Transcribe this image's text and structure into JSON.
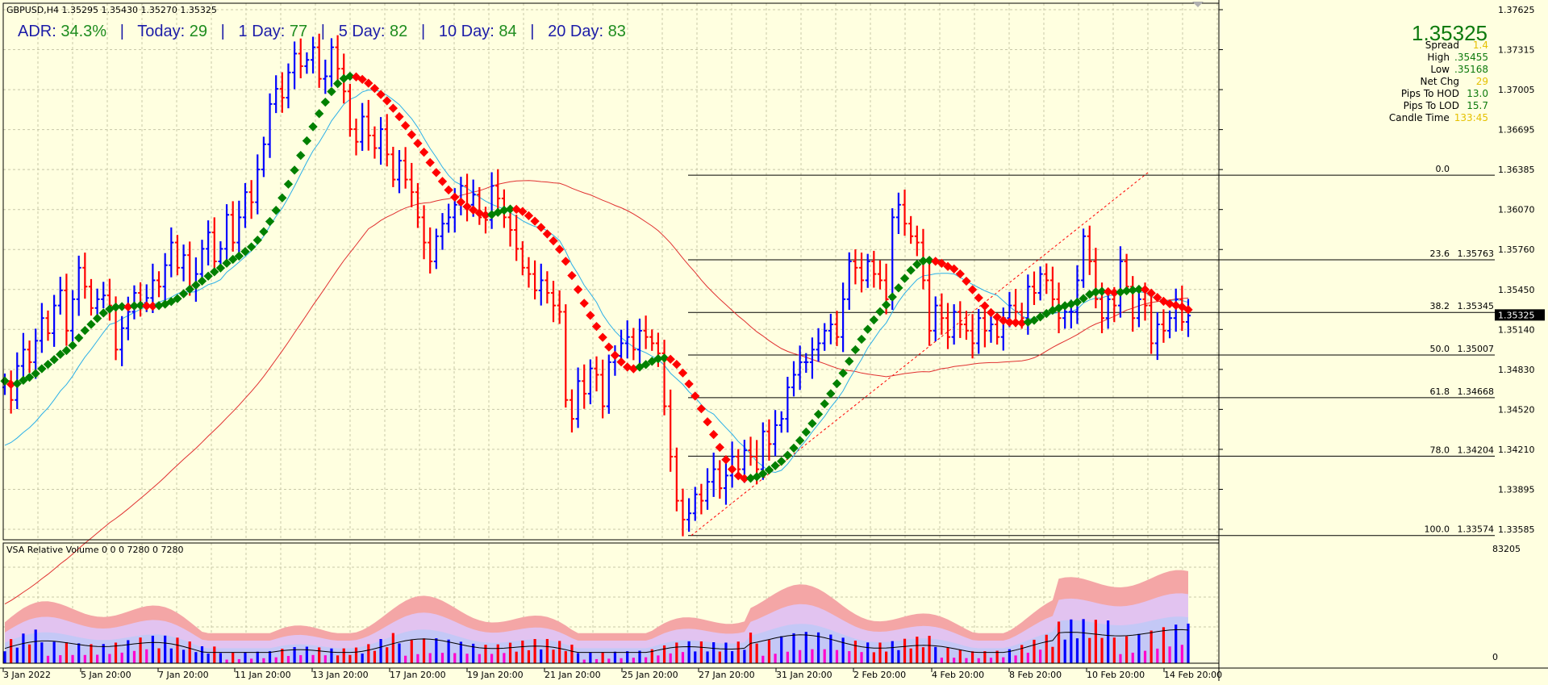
{
  "symbol_header": "GBPUSD,H4  1.35295 1.35430 1.35270 1.35325",
  "adr": {
    "parts": [
      {
        "label": "ADR:",
        "value": "34.3%",
        "sep": "|"
      },
      {
        "label": "Today:",
        "value": "29",
        "sep": "|"
      },
      {
        "label": "1 Day:",
        "value": "77",
        "sep": "|"
      },
      {
        "label": "5 Day:",
        "value": "82",
        "sep": "|"
      },
      {
        "label": "10 Day:",
        "value": "84",
        "sep": "|"
      },
      {
        "label": "20 Day:",
        "value": "83",
        "sep": ""
      }
    ]
  },
  "info_panel": {
    "price": "1.35325",
    "rows": [
      {
        "label": "Spread",
        "value": "1.4",
        "color": "yellow"
      },
      {
        "label": "High",
        "value": ".35455",
        "color": "green"
      },
      {
        "label": "Low",
        "value": ".35168",
        "color": "green"
      },
      {
        "label": "Net Chg",
        "value": "29",
        "color": "yellow"
      },
      {
        "label": "Pips To HOD",
        "value": "13.0",
        "color": "green"
      },
      {
        "label": "Pips To LOD",
        "value": "15.7",
        "color": "green"
      },
      {
        "label": "Candle Time",
        "value": "133:45",
        "color": "yellow"
      }
    ]
  },
  "indicator_header": "VSA Relative Volume 0 0 0 7280 0 7280",
  "colors": {
    "background": "#FFFFE0",
    "up_bar": "#0000FF",
    "down_bar": "#FF0000",
    "ma_fast": "#2CB0E8",
    "ma_slow": "#E03030",
    "trail_up": "#008000",
    "trail_down": "#FF0000",
    "grid": "#C8C8A8"
  },
  "chart_data": {
    "type": "ohlc",
    "title": "GBPUSD,H4",
    "ylim": [
      1.3354,
      1.378
    ],
    "y_ticks": [
      "1.37625",
      "1.37315",
      "1.37005",
      "1.36695",
      "1.36385",
      "1.36070",
      "1.35760",
      "1.35450",
      "1.35140",
      "1.34830",
      "1.34520",
      "1.34210",
      "1.33895",
      "1.33585"
    ],
    "current_price_label": "1.35325",
    "current_price": 1.35325,
    "x_ticks": [
      "3 Jan 2022",
      "5 Jan 20:00",
      "7 Jan 20:00",
      "11 Jan 20:00",
      "13 Jan 20:00",
      "17 Jan 20:00",
      "19 Jan 20:00",
      "21 Jan 20:00",
      "25 Jan 20:00",
      "27 Jan 20:00",
      "31 Jan 20:00",
      "2 Feb 20:00",
      "4 Feb 20:00",
      "8 Feb 20:00",
      "10 Feb 20:00",
      "14 Feb 20:00"
    ],
    "closes": [
      1.348,
      1.3465,
      1.3492,
      1.3505,
      1.3495,
      1.3512,
      1.353,
      1.3518,
      1.354,
      1.3552,
      1.352,
      1.3545,
      1.357,
      1.3555,
      1.3538,
      1.3545,
      1.3548,
      1.354,
      1.3505,
      1.3522,
      1.3535,
      1.355,
      1.3542,
      1.3546,
      1.356,
      1.3555,
      1.3572,
      1.359,
      1.357,
      1.358,
      1.3555,
      1.3565,
      1.3585,
      1.3598,
      1.3575,
      1.3585,
      1.3612,
      1.359,
      1.361,
      1.363,
      1.3622,
      1.3648,
      1.3668,
      1.37,
      1.3712,
      1.3705,
      1.3725,
      1.374,
      1.373,
      1.3735,
      1.3745,
      1.372,
      1.3722,
      1.3745,
      1.3728,
      1.371,
      1.368,
      1.367,
      1.369,
      1.3675,
      1.3665,
      1.368,
      1.366,
      1.364,
      1.3655,
      1.364,
      1.363,
      1.361,
      1.359,
      1.3575,
      1.3595,
      1.3605,
      1.361,
      1.362,
      1.3635,
      1.362,
      1.3628,
      1.361,
      1.3608,
      1.3635,
      1.3625,
      1.361,
      1.36,
      1.3585,
      1.357,
      1.3565,
      1.3552,
      1.356,
      1.355,
      1.354,
      1.3535,
      1.3465,
      1.345,
      1.348,
      1.347,
      1.349,
      1.3485,
      1.346,
      1.3495,
      1.35,
      1.351,
      1.3515,
      1.3505,
      1.352,
      1.3515,
      1.351,
      1.3502,
      1.346,
      1.342,
      1.3385,
      1.337,
      1.3375,
      1.339,
      1.3385,
      1.34,
      1.341,
      1.3395,
      1.3405,
      1.342,
      1.341,
      1.3425,
      1.342,
      1.341,
      1.344,
      1.343,
      1.3445,
      1.345,
      1.3475,
      1.3485,
      1.3495,
      1.3495,
      1.3505,
      1.351,
      1.352,
      1.3525,
      1.3515,
      1.3545,
      1.3575,
      1.357,
      1.356,
      1.3575,
      1.3565,
      1.356,
      1.3545,
      1.361,
      1.362,
      1.3605,
      1.3595,
      1.359,
      1.356,
      1.352,
      1.354,
      1.353,
      1.3515,
      1.3535,
      1.3525,
      1.352,
      1.351,
      1.353,
      1.352,
      1.3525,
      1.3515,
      1.353,
      1.354,
      1.3535,
      1.353,
      1.3555,
      1.355,
      1.3565,
      1.356,
      1.3545,
      1.353,
      1.3535,
      1.3535,
      1.356,
      1.3595,
      1.3575,
      1.3545,
      1.353,
      1.3545,
      1.354,
      1.3575,
      1.3555,
      1.353,
      1.3545,
      1.354,
      1.351,
      1.3525,
      1.352,
      1.353,
      1.3545,
      1.3527,
      1.3532
    ],
    "ma_fast_note": "blue moving average",
    "ma_slow_note": "red moving average",
    "fibonacci": {
      "from": 1.33574,
      "to": 1.36435,
      "levels": [
        {
          "ratio": "0.0",
          "price": 1.36435,
          "label": ""
        },
        {
          "ratio": "23.6",
          "price": 1.35763,
          "label": "1.35763"
        },
        {
          "ratio": "38.2",
          "price": 1.35345,
          "label": "1.35345"
        },
        {
          "ratio": "50.0",
          "price": 1.35007,
          "label": "1.35007"
        },
        {
          "ratio": "61.8",
          "price": 1.34668,
          "label": "1.34668"
        },
        {
          "ratio": "78.0",
          "price": 1.34204,
          "label": "1.34204"
        },
        {
          "ratio": "100.0",
          "price": 1.33574,
          "label": "1.33574"
        }
      ]
    },
    "volume": {
      "ymax_label": "83205",
      "ymin_label": "0",
      "ymax": 83205
    }
  }
}
